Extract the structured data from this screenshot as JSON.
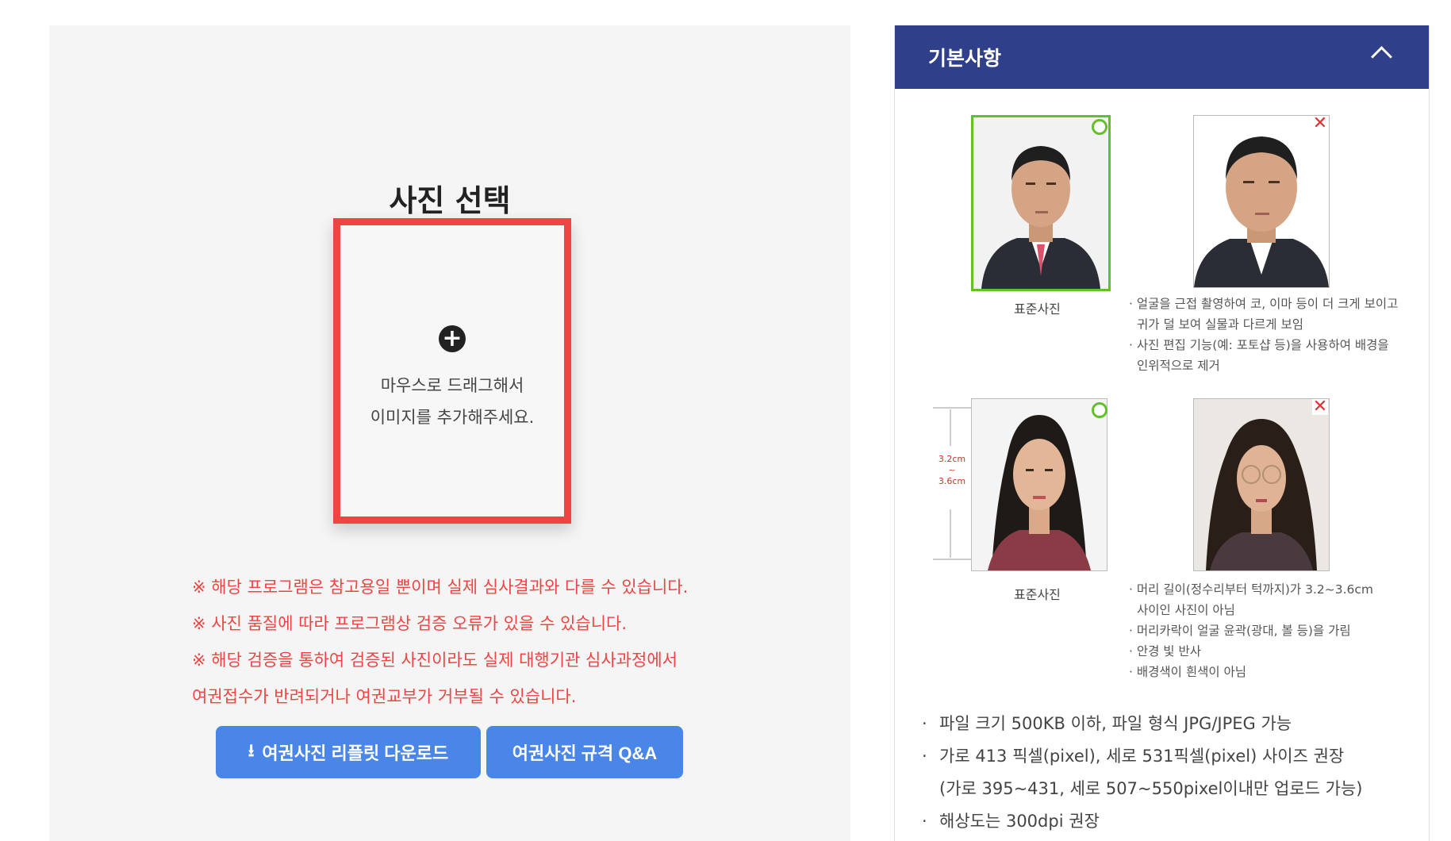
{
  "left": {
    "title": "사진 선택",
    "drop_line1": "마우스로 드래그해서",
    "drop_line2": "이미지를 추가해주세요.",
    "notices": [
      "※ 해당 프로그램은 참고용일 뿐이며 실제 심사결과와 다를 수 있습니다.",
      "※ 사진 품질에 따라 프로그램상 검증 오류가 있을 수 있습니다.",
      "※ 해당 검증을 통하여 검증된 사진이라도 실제 대행기관 심사과정에서",
      "여권접수가 반려되거나 여권교부가 거부될 수 있습니다."
    ],
    "download_button": "여권사진 리플릿 다운로드",
    "qa_button": "여권사진 규격 Q&A"
  },
  "right": {
    "header_title": "기본사항",
    "standard_caption_1": "표준사진",
    "bad_desc_1": [
      "· 얼굴을 근접 촬영하여 코, 이마 등이 더 크게 보이고",
      "  귀가 덜 보여 실물과 다르게 보임",
      "· 사진 편집 기능(예: 포토샵 등)을 사용하여 배경을",
      "  인위적으로 제거"
    ],
    "standard_caption_2": "표준사진",
    "measure_top": "3.2cm",
    "measure_mid": "~",
    "measure_bottom": "3.6cm",
    "bad_desc_2": [
      "· 머리 길이(정수리부터 턱까지)가 3.2~3.6cm",
      "  사이인 사진이 아님",
      "· 머리카락이 얼굴 윤곽(광대, 볼 등)을 가림",
      "· 안경 빛 반사",
      "· 배경색이 흰색이 아님"
    ],
    "bullets": [
      "파일 크기 500KB 이하, 파일 형식 JPG/JPEG 가능",
      "가로 413 픽셀(pixel), 세로 531픽셀(pixel) 사이즈 권장",
      "(가로 395~431, 세로 507~550pixel이내만 업로드 가능)",
      "해상도는 300dpi 권장"
    ],
    "bullet_mark": "·",
    "ok_mark_color": "#62c02a",
    "bad_mark_color": "#e03030",
    "bad_mark": "✕"
  },
  "colors": {
    "header_bg": "#2f3f8a",
    "button_bg": "#4a86e8",
    "notice_red": "#ef4444",
    "dropzone_border": "#ef4444"
  }
}
